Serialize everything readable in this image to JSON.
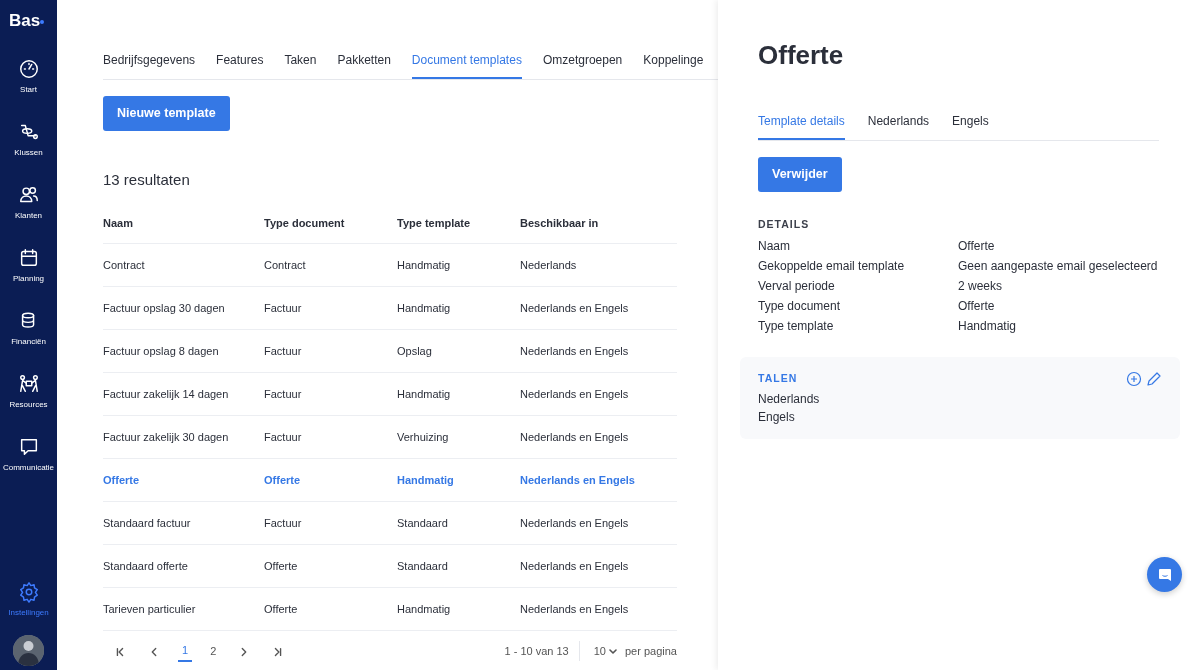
{
  "sidebar": {
    "logo": "Bas",
    "items": [
      {
        "label": "Start",
        "selected": false
      },
      {
        "label": "Klussen",
        "selected": false
      },
      {
        "label": "Klanten",
        "selected": false
      },
      {
        "label": "Planning",
        "selected": false
      },
      {
        "label": "Financiën",
        "selected": false
      },
      {
        "label": "Resources",
        "selected": false
      },
      {
        "label": "Communicatie",
        "selected": false
      }
    ],
    "bottom_item": {
      "label": "Instellingen",
      "selected": true
    }
  },
  "tabs": [
    {
      "label": "Bedrijfsgegevens",
      "selected": false
    },
    {
      "label": "Features",
      "selected": false
    },
    {
      "label": "Taken",
      "selected": false
    },
    {
      "label": "Pakketten",
      "selected": false
    },
    {
      "label": "Document templates",
      "selected": true
    },
    {
      "label": "Omzetgroepen",
      "selected": false
    },
    {
      "label": "Koppelinge",
      "selected": false
    }
  ],
  "new_button": "Nieuwe template",
  "result_count": "13 resultaten",
  "table": {
    "columns": [
      "Naam",
      "Type document",
      "Type template",
      "Beschikbaar in"
    ],
    "rows": [
      {
        "cells": [
          "Contract",
          "Contract",
          "Handmatig",
          "Nederlands"
        ],
        "selected": false
      },
      {
        "cells": [
          "Factuur opslag 30 dagen",
          "Factuur",
          "Handmatig",
          "Nederlands en Engels"
        ],
        "selected": false
      },
      {
        "cells": [
          "Factuur opslag 8 dagen",
          "Factuur",
          "Opslag",
          "Nederlands en Engels"
        ],
        "selected": false
      },
      {
        "cells": [
          "Factuur zakelijk 14 dagen",
          "Factuur",
          "Handmatig",
          "Nederlands en Engels"
        ],
        "selected": false
      },
      {
        "cells": [
          "Factuur zakelijk 30 dagen",
          "Factuur",
          "Verhuizing",
          "Nederlands en Engels"
        ],
        "selected": false
      },
      {
        "cells": [
          "Offerte",
          "Offerte",
          "Handmatig",
          "Nederlands en Engels"
        ],
        "selected": true
      },
      {
        "cells": [
          "Standaard factuur",
          "Factuur",
          "Standaard",
          "Nederlands en Engels"
        ],
        "selected": false
      },
      {
        "cells": [
          "Standaard offerte",
          "Offerte",
          "Standaard",
          "Nederlands en Engels"
        ],
        "selected": false
      },
      {
        "cells": [
          "Tarieven particulier",
          "Offerte",
          "Handmatig",
          "Nederlands en Engels"
        ],
        "selected": false
      }
    ]
  },
  "pagination": {
    "pages": [
      {
        "label": "1",
        "selected": true
      },
      {
        "label": "2",
        "selected": false
      }
    ],
    "range": "1 - 10 van 13",
    "per_page": "10",
    "per_page_label": "per pagina"
  },
  "detail": {
    "title": "Offerte",
    "tabs": [
      {
        "label": "Template details",
        "selected": true
      },
      {
        "label": "Nederlands",
        "selected": false
      },
      {
        "label": "Engels",
        "selected": false
      }
    ],
    "delete_button": "Verwijder",
    "section_title": "DETAILS",
    "fields": [
      {
        "label": "Naam",
        "value": "Offerte"
      },
      {
        "label": "Gekoppelde email template",
        "value": "Geen aangepaste email geselecteerd"
      },
      {
        "label": "Verval periode",
        "value": "2 weeks"
      },
      {
        "label": "Type document",
        "value": "Offerte"
      },
      {
        "label": "Type template",
        "value": "Handmatig"
      }
    ],
    "languages": {
      "title": "TALEN",
      "items": [
        "Nederlands",
        "Engels"
      ]
    }
  }
}
